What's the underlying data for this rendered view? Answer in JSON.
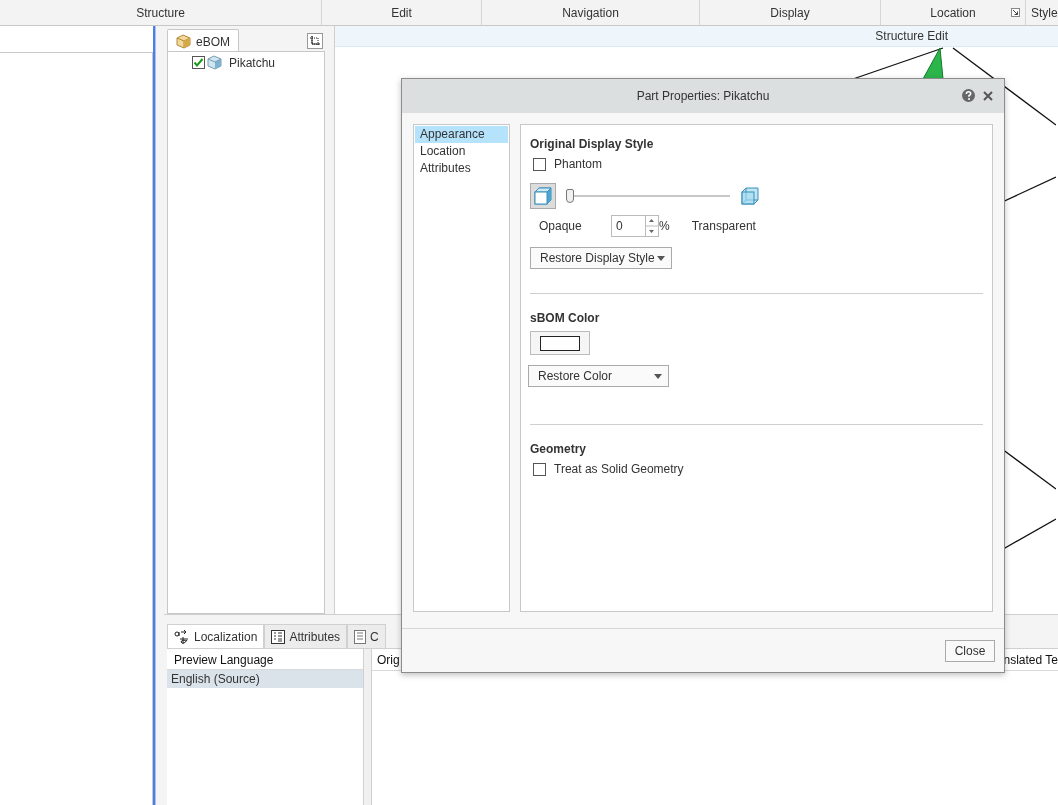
{
  "ribbon_groups": [
    {
      "label": "Structure",
      "launcher": false
    },
    {
      "label": "Edit",
      "launcher": false
    },
    {
      "label": "Navigation",
      "launcher": false
    },
    {
      "label": "Display",
      "launcher": false
    },
    {
      "label": "Location",
      "launcher": true
    },
    {
      "label": "Style",
      "launcher": false
    }
  ],
  "tree": {
    "tab": "eBOM",
    "items": [
      {
        "label": "Pikatchu",
        "checked": true
      }
    ]
  },
  "canvas": {
    "title": "Structure Edit"
  },
  "bottom_panel": {
    "tabs": [
      {
        "label": "Localization",
        "kind": "localization",
        "selected": true
      },
      {
        "label": "Attributes",
        "kind": "attributes",
        "selected": false
      },
      {
        "label": "C",
        "kind": "list",
        "selected": false
      }
    ],
    "language_list": {
      "header": "Preview Language",
      "items": [
        {
          "label": "English (Source)",
          "selected": true
        }
      ]
    },
    "table_columns": [
      "Orig",
      "nslated Te"
    ]
  },
  "dialog": {
    "title": "Part Properties: Pikatchu",
    "nav": [
      {
        "label": "Appearance",
        "selected": true
      },
      {
        "label": "Location",
        "selected": false
      },
      {
        "label": "Attributes",
        "selected": false
      }
    ],
    "display_style": {
      "heading": "Original Display Style",
      "phantom": {
        "label": "Phantom",
        "checked": false
      },
      "transparency": {
        "level": 0,
        "value": "0",
        "unit": "%",
        "min_label": "Opaque",
        "max_label": "Transparent"
      },
      "restore_button": "Restore Display Style"
    },
    "sbom_color": {
      "heading": "sBOM Color",
      "restore_button": "Restore Color"
    },
    "geometry": {
      "heading": "Geometry",
      "solid": {
        "label": "Treat as Solid Geometry",
        "checked": false
      }
    },
    "close_button": "Close"
  }
}
